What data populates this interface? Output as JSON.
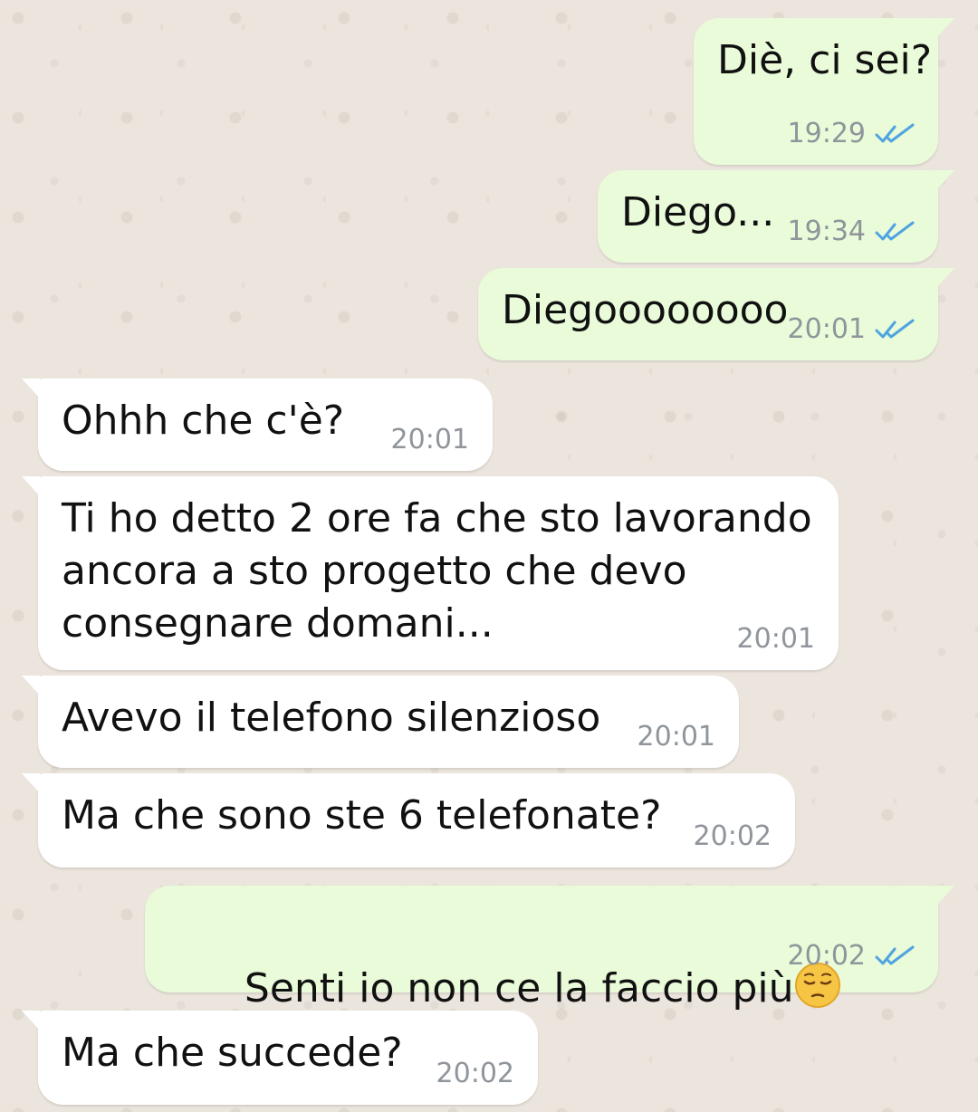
{
  "theme": {
    "wallpaper": "#ece5dd",
    "incoming_bubble": "#ffffff",
    "outgoing_bubble": "#e9fbd9",
    "timestamp_color": "#8f959b",
    "read_ticks_color": "#4fa3e0"
  },
  "messages": [
    {
      "direction": "outgoing",
      "text": "Diè, ci sei?",
      "time": "19:29",
      "status_icon": "double-check-read-icon"
    },
    {
      "direction": "outgoing",
      "text": "Diego...",
      "time": "19:34",
      "status_icon": "double-check-read-icon"
    },
    {
      "direction": "outgoing",
      "text": "Diegoooooooo",
      "time": "20:01",
      "status_icon": "double-check-read-icon"
    },
    {
      "direction": "incoming",
      "text": "Ohhh che c'è?",
      "time": "20:01"
    },
    {
      "direction": "incoming",
      "text": "Ti ho detto 2 ore fa che sto lavorando\nancora a sto progetto che devo\nconsegnare domani...",
      "time": "20:01"
    },
    {
      "direction": "incoming",
      "text": "Avevo il telefono silenzioso",
      "time": "20:01"
    },
    {
      "direction": "incoming",
      "text": "Ma che sono ste 6 telefonate?",
      "time": "20:02"
    },
    {
      "direction": "outgoing",
      "text": "Senti io non ce la faccio più",
      "emoji": "pensive-face-emoji",
      "time": "20:02",
      "status_icon": "double-check-read-icon"
    },
    {
      "direction": "incoming",
      "text": "Ma che succede?",
      "time": "20:02"
    }
  ]
}
